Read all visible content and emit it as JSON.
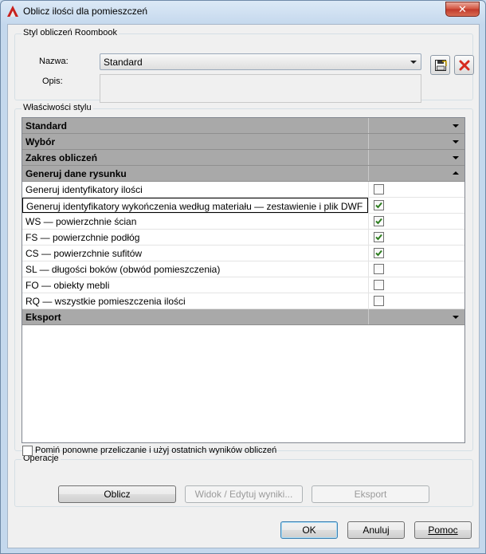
{
  "window": {
    "title": "Oblicz ilości dla pomieszczeń",
    "close_label": "✕"
  },
  "style_group": {
    "legend": "Styl obliczeń Roombook",
    "name_label": "Nazwa:",
    "name_value": "Standard",
    "desc_label": "Opis:",
    "desc_value": ""
  },
  "props_group": {
    "legend": "Właściwości stylu",
    "rows": [
      {
        "type": "category",
        "label": "Standard",
        "expanded": false
      },
      {
        "type": "category",
        "label": "Wybór",
        "expanded": false
      },
      {
        "type": "category",
        "label": "Zakres obliczeń",
        "expanded": false
      },
      {
        "type": "category",
        "label": "Generuj dane rysunku",
        "expanded": true
      },
      {
        "type": "item",
        "label": "Generuj identyfikatory ilości",
        "checked": false
      },
      {
        "type": "item",
        "label": "Generuj identyfikatory wykończenia według materiału — zestawienie i plik DWF",
        "checked": true,
        "selected": true
      },
      {
        "type": "item",
        "label": "WS — powierzchnie ścian",
        "checked": true
      },
      {
        "type": "item",
        "label": "FS — powierzchnie podłóg",
        "checked": true
      },
      {
        "type": "item",
        "label": "CS — powierzchnie sufitów",
        "checked": true
      },
      {
        "type": "item",
        "label": "SL — długości boków (obwód pomieszczenia)",
        "checked": false
      },
      {
        "type": "item",
        "label": "FO — obiekty mebli",
        "checked": false
      },
      {
        "type": "item",
        "label": "RQ — wszystkie pomieszczenia ilości",
        "checked": false
      },
      {
        "type": "category",
        "label": "Eksport",
        "expanded": false
      }
    ]
  },
  "operations": {
    "legend": "Operacje",
    "skip_label": "Pomiń ponowne przeliczanie i użyj ostatnich wyników obliczeń",
    "calc_label": "Oblicz",
    "view_label": "Widok / Edytuj wyniki...",
    "export_label": "Eksport"
  },
  "footer": {
    "ok_label": "OK",
    "cancel_label": "Anuluj",
    "help_label": "Pomoc"
  },
  "colors": {
    "category_bg": "#a9a9a9",
    "check_green": "#2d7d1f",
    "delete_red": "#d62a1e"
  }
}
